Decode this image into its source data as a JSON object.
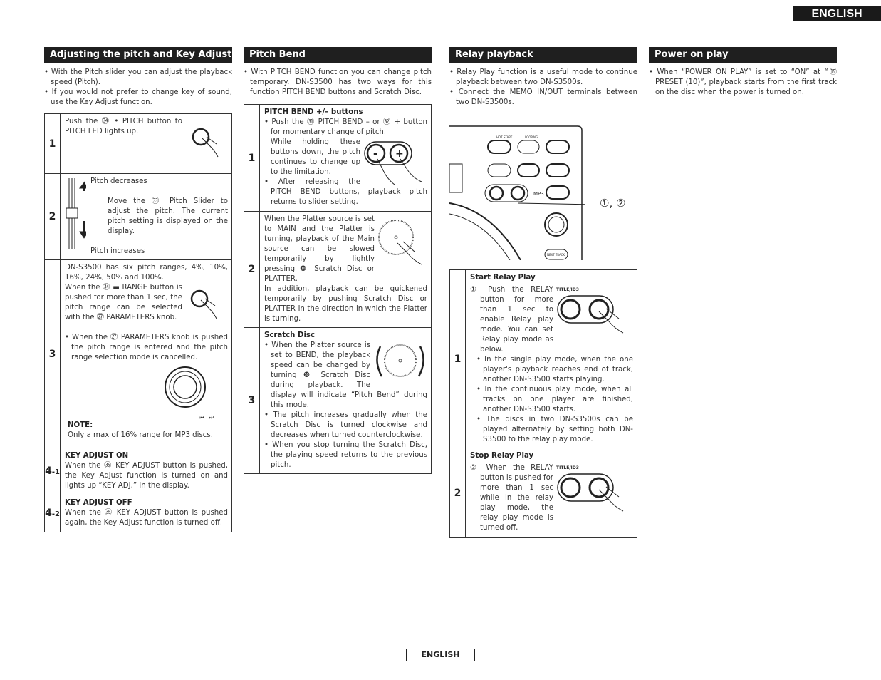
{
  "lang_tab": "ENGLISH",
  "footer": "ENGLISH",
  "pitch": {
    "title": "Adjusting the pitch and Key Adjust",
    "bullets": [
      "With the Pitch slider you can adjust the playback speed (Pitch).",
      "If you would not prefer to change key of sound, use the Key Adjust function."
    ],
    "steps": [
      {
        "num": "1",
        "text": "Push the ㉞ • PITCH button to PITCH LED lights up."
      },
      {
        "num": "2",
        "top": "Pitch decreases",
        "text": "Move the ㉝ Pitch Slider to adjust the pitch. The current pitch setting is displayed on the display.",
        "bottom": "Pitch increases"
      },
      {
        "num": "3",
        "p1": "DN-S3500 has six pitch ranges, 4%, 10%, 16%, 24%, 50% and 100%.",
        "p2": "When the ㉞ ▬ RANGE button is pushed for more than 1 sec, the pitch range can be selected with the ㉗ PARAMETERS knob.",
        "bullet": "When the ㉗ PARAMETERS knob is pushed the pitch range is entered and the pitch range selection mode is cancelled.",
        "knob_label": "⏮—⏭",
        "note_title": "NOTE:",
        "note": "Only a max of 16% range for MP3 discs."
      },
      {
        "num": "4",
        "sub": "-1",
        "title": "KEY ADJUST ON",
        "text": "When the ㉟ KEY ADJUST button is pushed, the Key Adjust function is turned on and lights up “KEY ADJ.” in the display."
      },
      {
        "num": "4",
        "sub": "-2",
        "title": "KEY ADJUST OFF",
        "text": "When the ㉟ KEY ADJUST button is pushed again, the Key Adjust function is turned off."
      }
    ]
  },
  "bend": {
    "title": "Pitch Bend",
    "bullets": [
      "With PITCH BEND function you can change pitch temporary. DN-S3500 has two ways for this function PITCH BEND buttons and Scratch Disc."
    ],
    "steps": [
      {
        "num": "1",
        "title": "PITCH BEND +/– buttons",
        "b1": "Push the ㉛ PITCH BEND – or ㉜ + button for momentary change of pitch.",
        "b1b": "While holding these buttons down, the pitch continues to change up to the limitation.",
        "b2": "After releasing the PITCH BEND buttons, playback pitch returns to slider setting."
      },
      {
        "num": "2",
        "p1": "When the Platter source is set to MAIN and the Platter is turning, playback of the Main source can be slowed temporarily by lightly pressing ❿ Scratch Disc or PLATTER.",
        "p2": "In addition, playback can be quickened temporarily by pushing Scratch Disc or PLATTER in the direction in which the Platter is turning."
      },
      {
        "num": "3",
        "title": "Scratch Disc",
        "b1": "When the Platter source is set to BEND, the playback speed can be changed by turning ❿ Scratch Disc during playback. The display will indicate “Pitch Bend” during this mode.",
        "b2": "The pitch increases gradually when the Scratch Disc is turned clockwise and decreases when turned counterclockwise.",
        "b3": "When you stop turning the Scratch Disc, the playing speed returns to the previous pitch."
      }
    ]
  },
  "relay": {
    "title": "Relay playback",
    "bullets": [
      "Relay Play function is a useful mode to continue playback between two DN-S3500s.",
      "Connect the MEMO IN/OUT terminals between two DN-S3500s."
    ],
    "callout": "①, ②",
    "device_labels": {
      "hot_start": "HOT START",
      "looping": "LOOPING",
      "mp3": "MP3",
      "next_track": "NEXT TRACK"
    },
    "steps": [
      {
        "num": "1",
        "title": "Start Relay Play",
        "p1": "① Push the RELAY button for more than 1 sec to enable Relay play mode. You can set Relay play mode as below.",
        "button_label": "TITLE/ID3",
        "b": [
          "In the single play mode, when the one player's playback reaches end of track, another DN-S3500 starts playing.",
          "In the continuous play mode, when all tracks on one player are finished, another DN-S3500 starts.",
          "The discs in two DN-S3500s can be played alternately by setting both DN-S3500 to the relay play mode."
        ]
      },
      {
        "num": "2",
        "title": "Stop Relay Play",
        "p1": "② When the RELAY button is pushed for more than 1 sec while in the relay play mode, the relay play mode is turned off.",
        "button_label": "TITLE/ID3"
      }
    ]
  },
  "power": {
    "title": "Power on play",
    "bullets": [
      "When “POWER ON PLAY” is set to “ON” at “⑮ PRESET (10)”, playback starts from the first track on the disc when the power is turned on."
    ]
  }
}
